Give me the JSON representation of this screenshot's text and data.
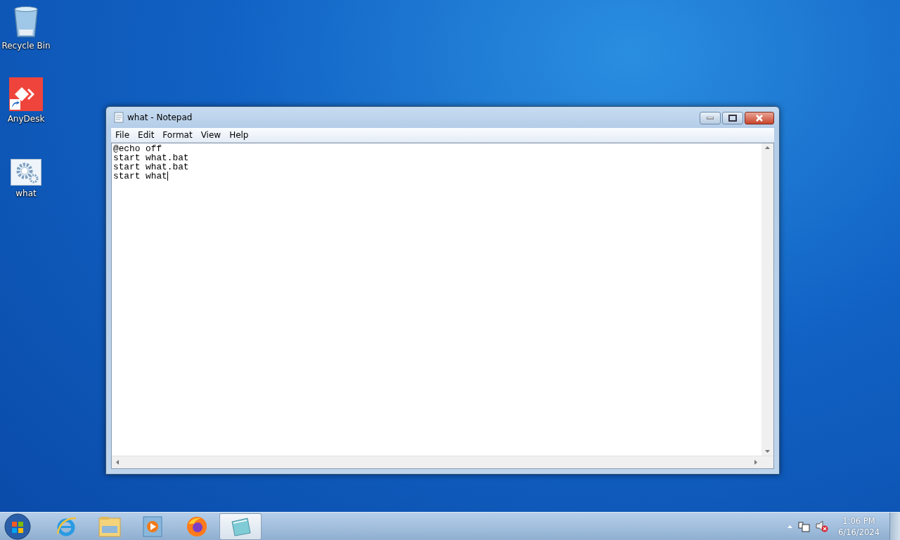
{
  "desktop_icons": [
    {
      "label": "Recycle Bin",
      "kind": "recycle"
    },
    {
      "label": "AnyDesk",
      "kind": "anydesk"
    },
    {
      "label": "what",
      "kind": "batch"
    }
  ],
  "window": {
    "title": "what - Notepad",
    "menu": [
      "File",
      "Edit",
      "Format",
      "View",
      "Help"
    ],
    "lines": [
      "@echo off",
      "start what.bat",
      "start what.bat",
      "start what"
    ]
  },
  "taskbar": {
    "apps": [
      {
        "kind": "ie",
        "selected": false
      },
      {
        "kind": "explorer",
        "selected": false
      },
      {
        "kind": "media",
        "selected": false
      },
      {
        "kind": "firefox",
        "selected": false
      },
      {
        "kind": "notepad",
        "selected": true
      }
    ],
    "time": "1:06 PM",
    "date": "6/16/2024"
  }
}
